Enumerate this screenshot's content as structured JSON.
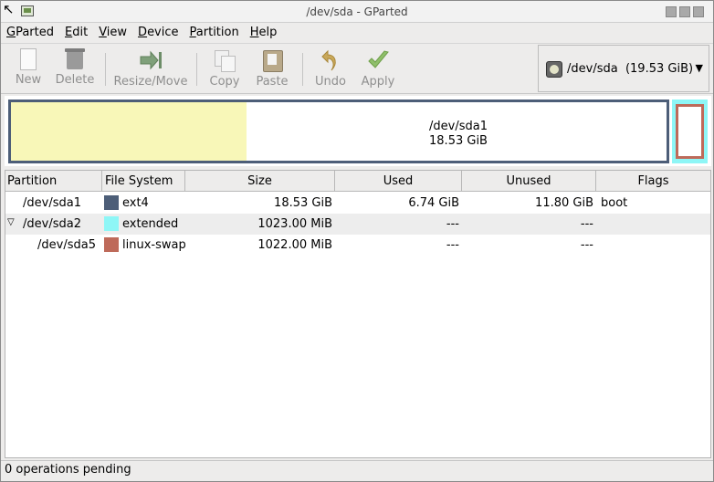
{
  "window": {
    "title": "/dev/sda - GParted"
  },
  "menubar": {
    "items": [
      {
        "mnemonic": "G",
        "rest": "Parted"
      },
      {
        "mnemonic": "E",
        "rest": "dit"
      },
      {
        "mnemonic": "V",
        "rest": "iew"
      },
      {
        "mnemonic": "D",
        "rest": "evice"
      },
      {
        "mnemonic": "P",
        "rest": "artition"
      },
      {
        "mnemonic": "H",
        "rest": "elp"
      }
    ]
  },
  "toolbar": {
    "new_label": "New",
    "delete_label": "Delete",
    "resize_label": "Resize/Move",
    "copy_label": "Copy",
    "paste_label": "Paste",
    "undo_label": "Undo",
    "apply_label": "Apply"
  },
  "device": {
    "path": "/dev/sda",
    "size": "(19.53 GiB)"
  },
  "map": {
    "sda1_name": "/dev/sda1",
    "sda1_size": "18.53 GiB",
    "sda1_used_fraction": 0.36,
    "colors": {
      "ext4": "#4d5e78",
      "used_fill": "#f8f7b8",
      "extended": "#8ef6f6",
      "linux_swap": "#be6a5a"
    }
  },
  "table": {
    "columns": [
      "Partition",
      "File System",
      "Size",
      "Used",
      "Unused",
      "Flags"
    ],
    "rows": [
      {
        "partition": "/dev/sda1",
        "fs": "ext4",
        "size": "18.53 GiB",
        "used": "6.74 GiB",
        "unused": "11.80 GiB",
        "flags": "boot"
      },
      {
        "partition": "/dev/sda2",
        "fs": "extended",
        "size": "1023.00 MiB",
        "used": "---",
        "unused": "---",
        "flags": ""
      },
      {
        "partition": "/dev/sda5",
        "fs": "linux-swap",
        "size": "1022.00 MiB",
        "used": "---",
        "unused": "---",
        "flags": ""
      }
    ]
  },
  "status": {
    "text": "0 operations pending"
  }
}
